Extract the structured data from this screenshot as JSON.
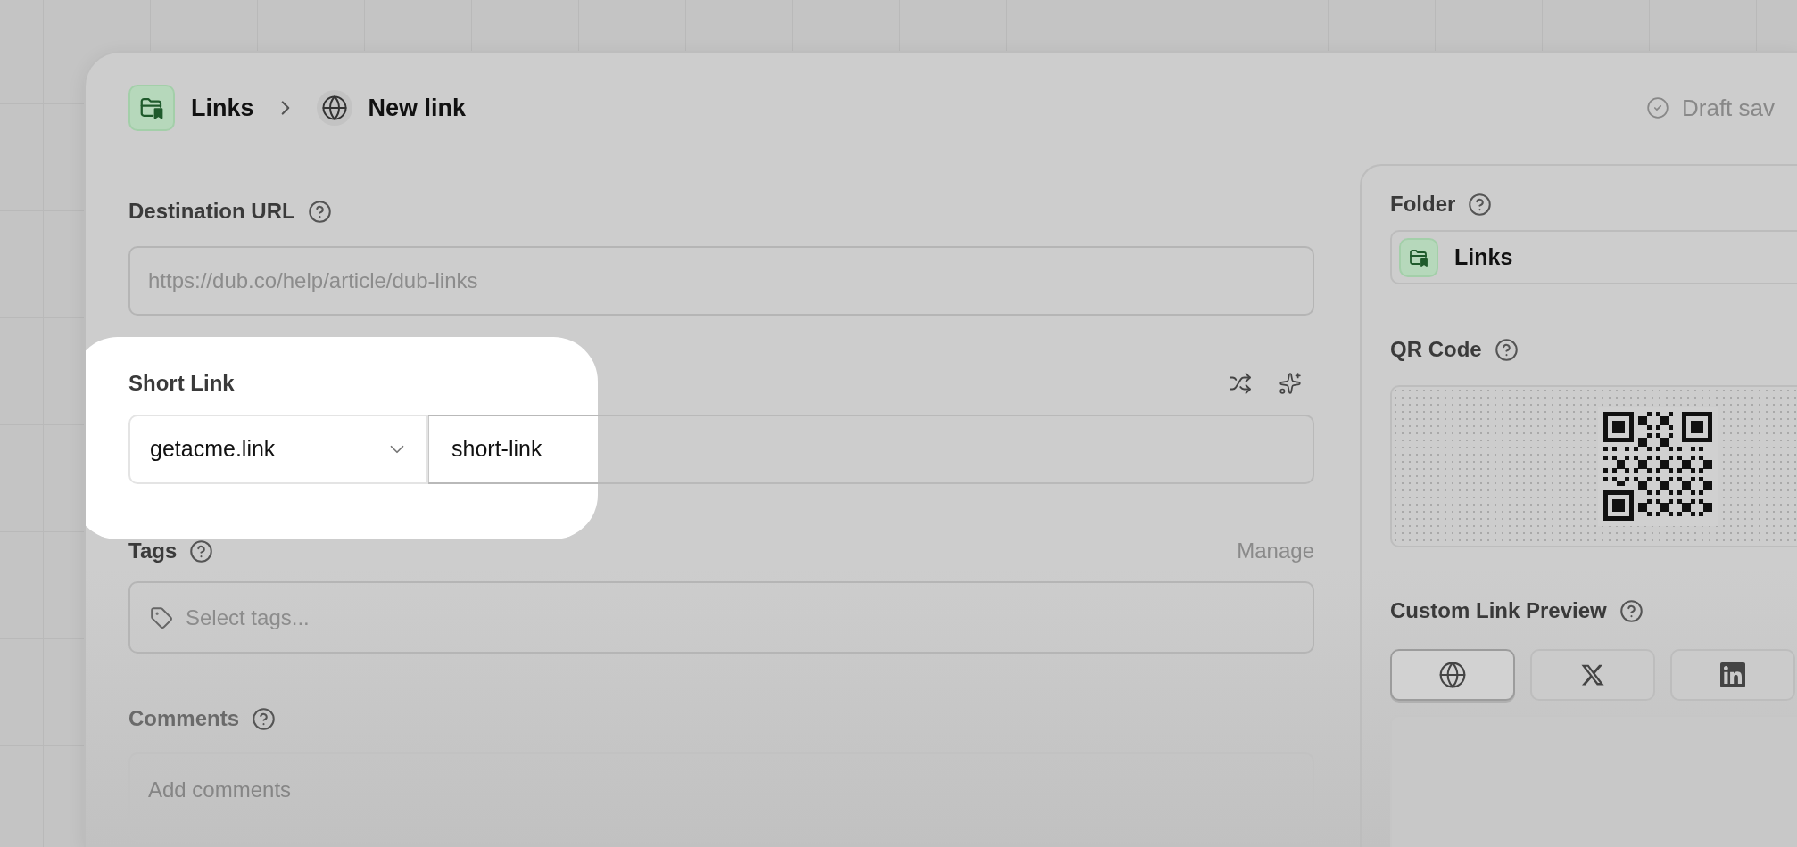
{
  "breadcrumb": [
    {
      "kind": "folder",
      "label": "Links"
    },
    {
      "kind": "globe",
      "label": "New link"
    }
  ],
  "status": "Draft sav",
  "destination_url": {
    "label": "Destination URL",
    "placeholder": "https://dub.co/help/article/dub-links"
  },
  "short_link": {
    "label": "Short Link",
    "domain": "getacme.link",
    "value": "short-link",
    "highlighted": true
  },
  "tags": {
    "label": "Tags",
    "action": "Manage",
    "placeholder": "Select tags..."
  },
  "comments": {
    "label": "Comments",
    "placeholder": "Add comments"
  },
  "folder": {
    "label": "Folder",
    "value": "Links"
  },
  "qr_code": {
    "label": "QR Code"
  },
  "link_preview": {
    "label": "Custom Link Preview",
    "tabs": [
      {
        "kind": "web",
        "selected": true
      },
      {
        "kind": "x",
        "selected": false
      },
      {
        "kind": "linkedin",
        "selected": false
      }
    ]
  }
}
